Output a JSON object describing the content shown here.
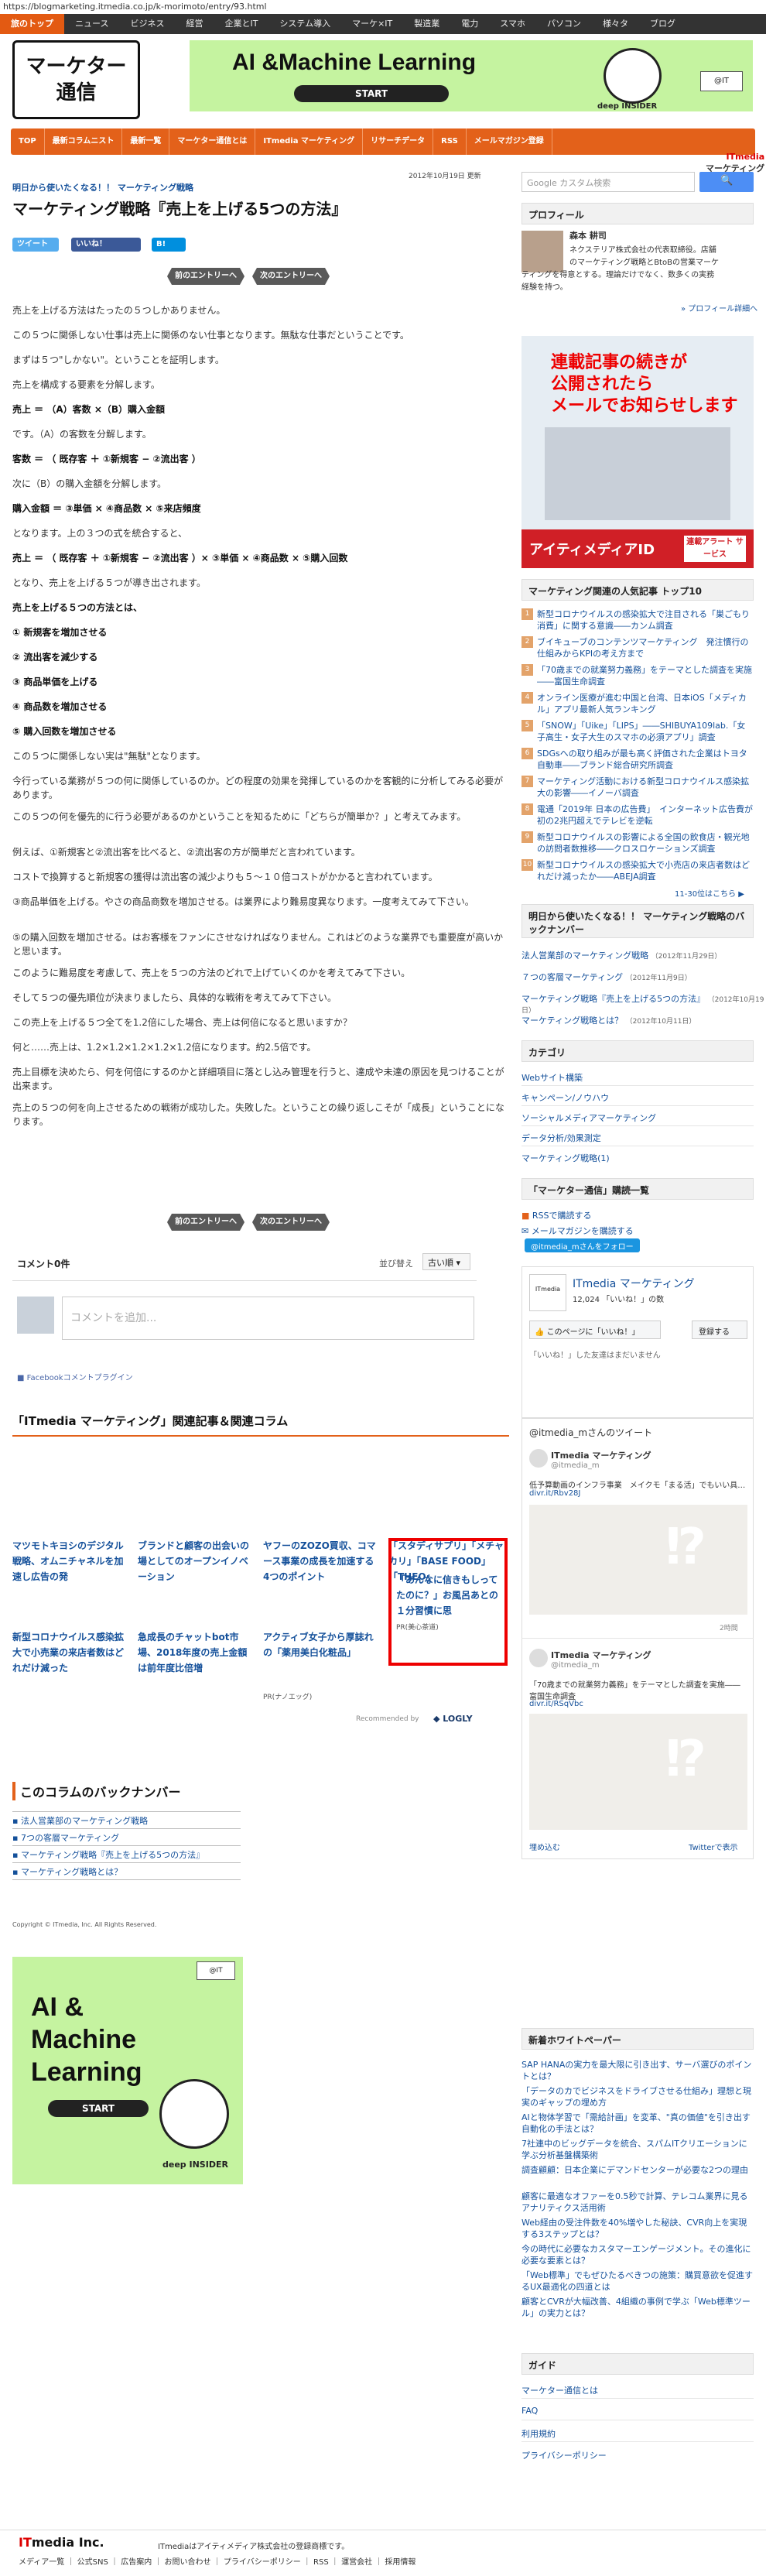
{
  "url": "https://blogmarketing.itmedia.co.jp/k-morimoto/entry/93.html",
  "gnav": [
    "旅のトップ",
    "ニュース",
    "ビジネス",
    "経営",
    "企業とIT",
    "システム導入",
    "マーケ×IT",
    "製造業",
    "電力",
    "スマホ",
    "パソコン",
    "様々タ",
    "ブログ"
  ],
  "logo": {
    "line1": "マーケター",
    "line2": "通信"
  },
  "top_banner": {
    "title": "AI &Machine Learning",
    "start": "START",
    "deep": "deep INSIDER",
    "it": "@IT"
  },
  "onav": [
    "TOP",
    "最新コラムニスト",
    "最新一覧",
    "マーケター通信とは",
    "ITmedia マーケティング",
    "リサーチデータ",
    "RSS",
    "メールマガジン登録"
  ],
  "article": {
    "date": "2012年10月19日 更新",
    "category": "明日から使いたくなる！！ マーケティング戦略",
    "title": "マーケティング戦略『売上を上げる5つの方法』",
    "tweet": "ツイート",
    "like": "いいね！",
    "hatena": "B!",
    "prev": "前のエントリーへ",
    "next": "次のエントリーへ",
    "paragraphs": [
      "売上を上げる方法はたったの５つしかありません。",
      "この５つに関係しない仕事は売上に関係のない仕事となります。無駄な仕事だということです。",
      "まずは５つ\"しかない\"。ということを証明します。",
      "売上を構成する要素を分解します。",
      "売上 ＝ （A）客数 ×（B）購入金額",
      "です。（A）の客数を分解します。",
      "客数 ＝ （ 既存客 ＋ ①新規客 − ②流出客 ）",
      "次に（B）の購入金額を分解します。",
      "購入金額 ＝ ③単価 × ④商品数 × ⑤来店頻度",
      "となります。上の３つの式を統合すると、",
      "売上 ＝ （ 既存客 ＋ ①新規客 − ②流出客 ）× ③単価 × ④商品数 × ⑤購入回数",
      "となり、売上を上げる５つが導き出されます。",
      "売上を上げる５つの方法とは、",
      "① 新規客を増加させる",
      "② 流出客を減少する",
      "③ 商品単価を上げる",
      "④ 商品数を増加させる",
      "⑤ 購入回数を増加させる",
      "この５つに関係しない実は\"無駄\"となります。",
      "今行っている業務が５つの何に関係しているのか。どの程度の効果を発揮しているのかを客観的に分析してみる必要があります。",
      "この５つの何を優先的に行う必要があるのかということを知るために「どちらが簡単か？」と考えてみます。",
      "例えば、①新規客と②流出客を比べると、②流出客の方が簡単だと言われています。",
      "コストで換算すると新規客の獲得は流出客の減少よりも５〜１０倍コストがかかると言われています。",
      "③商品単価を上げる。やさの商品商数を増加させる。は業界により難易度異なります。一度考えてみて下さい。",
      "⑤の購入回数を増加させる。はお客様をファンにさせなければなりません。これはどのような業界でも重要度が高いかと思います。",
      "このように難易度を考慮して、売上を５つの方法のどれで上げていくのかを考えてみて下さい。",
      "そして５つの優先順位が決まりましたら、具体的な戦術を考えてみて下さい。",
      "この売上を上げる５つ全てを1.2倍にした場合、売上は何倍になると思いますか？",
      "何と……売上は、1.2×1.2×1.2×1.2×1.2倍になります。約2.5倍です。",
      "売上目標を決めたら、何を何倍にするのかと詳細項目に落とし込み管理を行うと、達成や未達の原因を見つけることが出来ます。",
      "売上の５つの何を向上させるための戦術が成功した。失敗した。ということの繰り返しこそが「成長」ということになります。"
    ]
  },
  "comments": {
    "count": "コメント0件",
    "sort_label": "並び替え",
    "sort_value": "古い順",
    "placeholder": "コメントを追加...",
    "plugin": "Facebookコメントプラグイン"
  },
  "related": {
    "heading": "「ITmedia マーケティング」関連記事＆関連コラム",
    "row1": [
      "マツモトキヨシのデジタル戦略、オムニチャネルを加速し広告の発",
      "ブランドと顧客の出会いの場としてのオープンイノベーション",
      "ヤフーのZOZO買収、コマース事業の成長を加速する4つのポイント",
      "「スタディサプリ」「メチャカリ」「BASE FOOD」「THEO」"
    ],
    "row2": [
      "新型コロナウイルス感染拡大で小売業の来店者数はどれだけ減った",
      "急成長のチャットbot市場、2018年度の売上金額は前年度比倍増",
      "アクティブ女子から厚誌れの「薬用美白化粧品」"
    ],
    "ad": "「あんなに信きもしってたのに？」お風呂あとの１分習慣に思",
    "pr1": "PR(ナノエッグ)",
    "pr2": "PR(美心茶道)",
    "recommended": "Recommended by",
    "logly": "LOGLY"
  },
  "backnumber": {
    "heading": "このコラムのバックナンバー",
    "items": [
      "法人営業部のマーケティング戦略",
      "7つの客層マーケティング",
      "マーケティング戦略『売上を上げる5つの方法』",
      "マーケティング戦略とは？"
    ]
  },
  "copyright": "Copyright © ITmedia, Inc. All Rights Reserved.",
  "left_banner": {
    "it": "@IT",
    "title1": "AI &",
    "title2": "Machine",
    "title3": "Learning",
    "start": "START",
    "deep": "deep INSIDER"
  },
  "footer": {
    "logo_prefix": "IT",
    "logo_main": "media Inc.",
    "text": "ITmediaはアイティメディア株式会社の登録商標です。",
    "links": "メディア一覧 ｜ 公式SNS ｜ 広告案内 ｜ お問い合わせ ｜ プライバシーポリシー ｜ RSS ｜ 運営会社 ｜ 採用情報"
  },
  "sidebar": {
    "search_placeholder": "Google カスタム検索",
    "itmedia_logo_top": "ITmedia",
    "itmedia_logo_bottom": "マーケティング",
    "profile_head": "プロフィール",
    "profile_name": "森本 耕司",
    "profile_text": [
      "ネクステリア株式会社の代表取締役。店舗",
      "のマーケティング戦略とBtoBの営業マーケ",
      "ティングを得意とする。理論だけでなく、数多くの実務",
      "経験を持つ。"
    ],
    "profile_more": "» プロフィール詳細へ",
    "ad_head1": "連載記事の続きが",
    "ad_head2": "公開されたら",
    "ad_head3": "メールでお知らせします",
    "ad_bottom": "アイティメディアID",
    "ad_badge": "連載アラート サービス",
    "ranking_head": "マーケティング関連の人気記事 トップ10",
    "ranking": [
      "新型コロナウイルスの感染拡大で注目される「巣ごもり消費」に関する意識――カンム調査",
      "ブイキューブのコンテンツマーケティング　発注慣行の仕組みからKPIの考え方まで",
      "「70歳までの就業努力義務」をテーマとした調査を実施――富国生命調査",
      "オンライン医療が進む中国と台湾、日本iOS「メディカル」アプリ最新人気ランキング",
      "「SNOW」「Uike」「LIPS」――SHIBUYA109lab.「女子高生・女子大生のスマホの必須アプリ」調査",
      "SDGsへの取り組みが最も高く評価された企業はトヨタ自動車――ブランド総合研究所調査",
      "マーケティング活動における新型コロナウイルス感染拡大の影響――イノーバ調査",
      "電通「2019年 日本の広告費」　インターネット広告費が初の2兆円超えでテレビを逆転",
      "新型コロナウイルスの影響による全国の飲食店・観光地の訪問者数推移――クロスロケーションズ調査",
      "新型コロナウイルスの感染拡大で小売店の来店者数はどれだけ減ったか――ABEJA調査"
    ],
    "ranking_foot": "11-30位はこちら ▶",
    "cat_head": "明日から使いたくなる！！ マーケティング戦略のバックナンバー",
    "cat_items": [
      {
        "t": "法人営業部のマーケティング戦略",
        "d": "（2012年11月29日）"
      },
      {
        "t": "７つの客層マーケティング",
        "d": "（2012年11月9日）"
      },
      {
        "t": "マーケティング戦略『売上を上げる5つの方法』",
        "d": "（2012年10月19日）"
      },
      {
        "t": "マーケティング戦略とは？",
        "d": "（2012年10月11日）"
      }
    ],
    "category_head": "カテゴリ",
    "categories": [
      "Webサイト構築",
      "キャンペーン/ノウハウ",
      "ソーシャルメディアマーケティング",
      "データ分析/効果測定",
      "マーケティング戦略(1)"
    ],
    "mk_head": "「マーケター通信」購読一覧",
    "rss": "RSSで購読する",
    "mailmag": "メールマガジンを購読する",
    "follow": "@itmedia_mさんをフォロー",
    "fb_name": "ITmedia マーケティング",
    "fb_likes": "12,024 「いいね！」の数",
    "fb_share": "このページに「いいね！」",
    "fb_signup": "登録する",
    "fb_empty": "「いいね！」した友達はまだいません",
    "tw_head": "@itmedia_mさんのツイート",
    "tw_name": "ITmedia マーケティング",
    "tw_handle": "@itmedia_m",
    "tw_text1": "低予算動画のインフラ事業　メイクモ「まる活」でもいい具…",
    "tw_link1": "divr.it/Rbv28J",
    "tw_time": "2時間",
    "tw_text2": "「70歳までの就業努力義務」をテーマとした調査を実施――富国生命調査",
    "tw_link2": "divr.it/RSqVbc",
    "tw_embed": "埋め込む",
    "tw_view": "Twitterで表示",
    "wp_head": "新着ホワイトペーパー",
    "wp_items": [
      "SAP HANAの実力を最大限に引き出す、サーバ選びのポイントとは？",
      "「データのカでビジネスをドライブさせる仕組み」理想と現実のギャップの埋め方",
      "AIと物体学習で「需給計画」を変革、\"真の価値\"を引き出す自動化の手法とは？",
      "7社連中のビッグデータを統合、スパムITクリエーションに学ぶ分析基盤構築術",
      "調査顧顧：日本企業にデマンドセンターが必要な2つの理由",
      "顧客に最適なオファーを0.5秒で計算、テレコム業界に見るアナリティクス活用術",
      "Web経由の受注件数を40%増やした秘訣、CVR向上を実現する3ステップとは？",
      "今の時代に必要なカスタマーエンゲージメント。その進化に必要な要素とは？",
      "「Web標準」でもぜひたるべきつの施策：購買意欲を促進するUX最適化の四道とは",
      "顧客とCVRが大幅改善、4組織の事例で学ぶ「Web標準ツール」の実力とは？"
    ],
    "guide_head": "ガイド",
    "guide_items": [
      "マーケター通信とは",
      "FAQ",
      "利用規約",
      "プライバシーポリシー"
    ]
  },
  "colors": {
    "accent": "#e3611a",
    "link": "#14509a",
    "nav_bg": "#333333",
    "banner_green": "#c5f3a0"
  }
}
